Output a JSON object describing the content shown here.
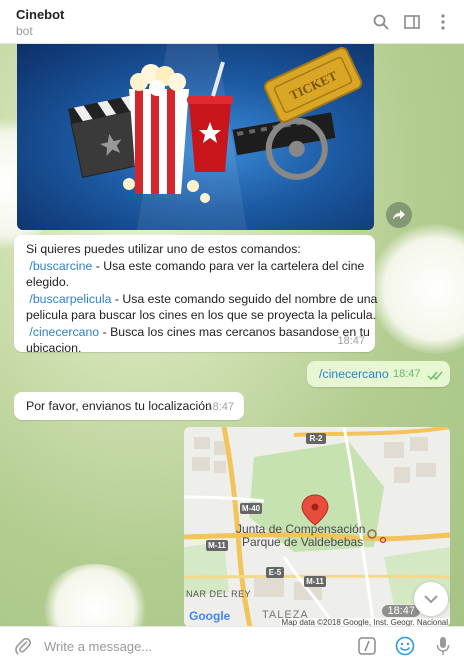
{
  "header": {
    "title": "Cinebot",
    "subtitle": "bot",
    "icons": [
      "search-icon",
      "sidebar-toggle-icon",
      "more-vertical-icon"
    ]
  },
  "messages": {
    "commands": {
      "intro": "Si quieres puedes utilizar uno de estos comandos:",
      "items": [
        {
          "command": "/buscarcine",
          "desc": " - Usa este comando para ver la cartelera del cine"
        },
        {
          "command": "/buscarpelicula",
          "desc": " - Usa este comando seguido del nombre de una"
        },
        {
          "command": "/cinecercano",
          "desc": " - Busca los cines mas cercanos basandose en tu"
        }
      ],
      "line_buscarcine_2": "elegido.",
      "line_buscarpelicula_2": "pelicula para buscar los cines en los que se proyecta la pelicula.",
      "line_cinecercano_2": "ubicacion.",
      "time": "18:47"
    },
    "user_command": {
      "text": "/cinecercano",
      "time": "18:47"
    },
    "location_request": {
      "text": "Por favor, envianos tu localización",
      "time": "18:47"
    },
    "map": {
      "poi_line1": "Junta de Compensación",
      "poi_line2": "Parque de Valdebebas",
      "road_labels": [
        "R-2",
        "M-40",
        "M-11",
        "E-5",
        "M-11"
      ],
      "area_label": "NAR DEL REY",
      "area_label_2": "TALEZA",
      "brand": "Google",
      "attribution": "Map data ©2018 Google, Inst. Geogr. Nacional",
      "time": "18:47"
    }
  },
  "composer": {
    "placeholder": "Write a message...",
    "icons": [
      "attach-icon",
      "command-icon",
      "emoji-icon",
      "microphone-icon"
    ]
  },
  "colors": {
    "link": "#2e82c7",
    "outgoing_bubble": "#e6f7d2",
    "read_checks": "#6fb86a",
    "accent": "#2e9bd8"
  }
}
